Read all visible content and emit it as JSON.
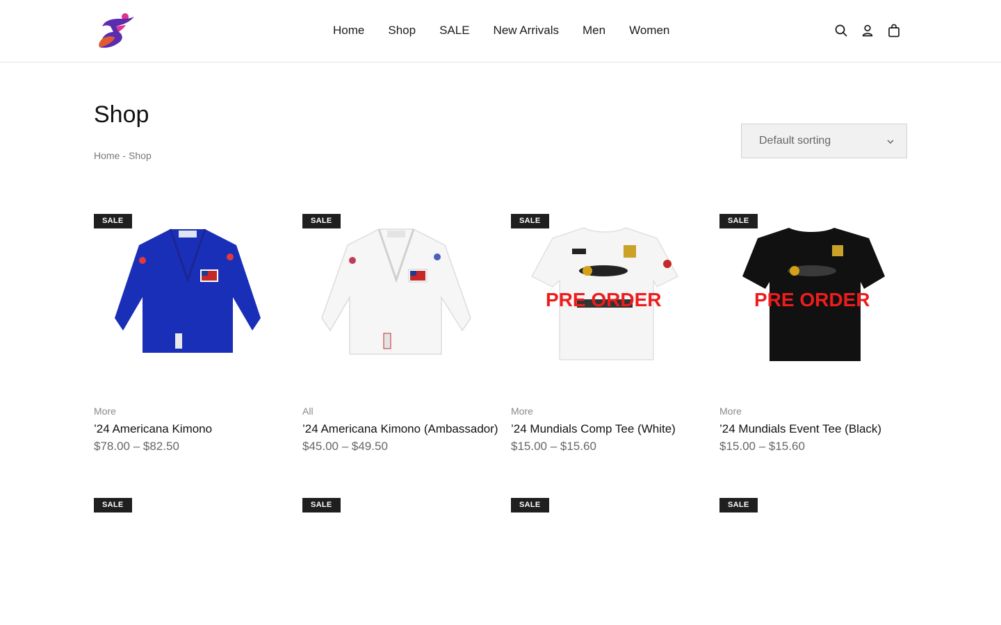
{
  "nav": {
    "items": [
      "Home",
      "Shop",
      "SALE",
      "New Arrivals",
      "Men",
      "Women"
    ]
  },
  "header_icons": [
    "search-icon",
    "user-icon",
    "cart-icon"
  ],
  "page": {
    "title": "Shop",
    "breadcrumb": {
      "home": "Home",
      "separator": "-",
      "current": "Shop"
    }
  },
  "sorting": {
    "selected": "Default sorting"
  },
  "products": [
    {
      "badge": "SALE",
      "category": "More",
      "title": "’24 Americana Kimono",
      "price": "$78.00 – $82.50",
      "image": "blue-kimono"
    },
    {
      "badge": "SALE",
      "category": "All",
      "title": "’24 Americana Kimono (Ambassador)",
      "price": "$45.00 – $49.50",
      "image": "white-kimono"
    },
    {
      "badge": "SALE",
      "category": "More",
      "title": "’24 Mundials Comp Tee (White)",
      "price": "$15.00 – $15.60",
      "image": "white-tee",
      "overlay": "PRE ORDER"
    },
    {
      "badge": "SALE",
      "category": "More",
      "title": "’24 Mundials Event Tee (Black)",
      "price": "$15.00 – $15.60",
      "image": "black-tee",
      "overlay": "PRE ORDER"
    }
  ],
  "second_row_badges": [
    "SALE",
    "SALE",
    "SALE",
    "SALE"
  ],
  "colors": {
    "badge_bg": "#1f1f1f",
    "preorder_red": "#ee1c1c",
    "kimono_blue": "#1a2fb8"
  }
}
